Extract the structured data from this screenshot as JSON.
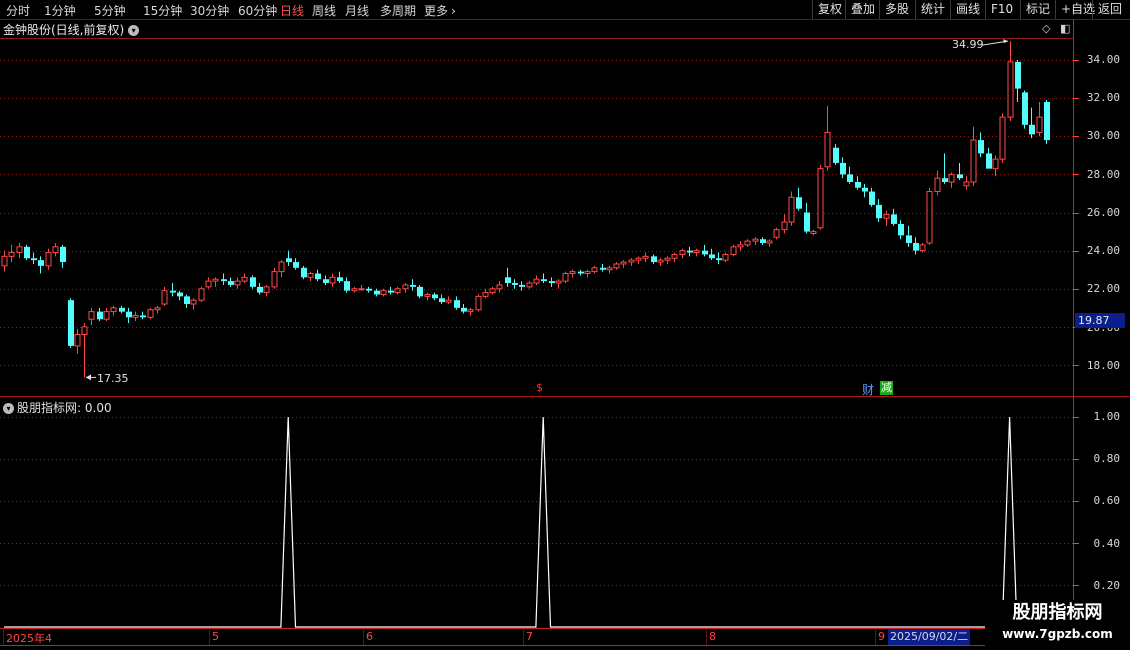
{
  "toolbar": {
    "periods": [
      {
        "label": "分时",
        "active": false
      },
      {
        "label": "1分钟",
        "active": false
      },
      {
        "label": "5分钟",
        "active": false
      },
      {
        "label": "15分钟",
        "active": false
      },
      {
        "label": "30分钟",
        "active": false
      },
      {
        "label": "60分钟",
        "active": false
      },
      {
        "label": "日线",
        "active": true
      },
      {
        "label": "周线",
        "active": false
      },
      {
        "label": "月线",
        "active": false
      },
      {
        "label": "多周期",
        "active": false
      },
      {
        "label": "更多",
        "active": false
      }
    ],
    "more_arrow": "›",
    "right_buttons": [
      "复权",
      "叠加",
      "多股",
      "统计",
      "画线",
      "F10",
      "标记",
      "+自选",
      "返回"
    ]
  },
  "main_chart": {
    "title": "金钟股份(日线,前复权)",
    "y_labels": [
      "34.00",
      "32.00",
      "30.00",
      "28.00",
      "26.00",
      "24.00",
      "22.00",
      "20.00",
      "18.00"
    ],
    "current_price": "19.87",
    "high_label": "34.99",
    "low_label": "17.35",
    "events": {
      "s": "$",
      "cai": "财",
      "jian": "减"
    },
    "colors": {
      "up": "#ff4848",
      "down": "#54fcfc",
      "grid": "#8b1a1a",
      "axis": "#ff3c3c"
    }
  },
  "indicator": {
    "name": "股朋指标网",
    "value_text": ": 0.00",
    "y_labels": [
      "1.00",
      "0.80",
      "0.60",
      "0.40",
      "0.20"
    ],
    "line_color": "#ffffff"
  },
  "time_axis": {
    "labels": [
      "2025年4",
      "5",
      "6",
      "7",
      "8",
      "9"
    ],
    "cursor_date": "2025/09/02/二"
  },
  "watermark": {
    "line1": "股朋指标网",
    "line2": "www.7gpzb.com"
  },
  "chart_data": {
    "type": "candlestick",
    "ylim": [
      17,
      35.5
    ],
    "high": 34.99,
    "low": 17.35,
    "ohlc": [
      [
        23.2,
        24.0,
        22.9,
        23.7
      ],
      [
        23.7,
        24.3,
        23.4,
        23.9
      ],
      [
        23.9,
        24.4,
        23.6,
        24.2
      ],
      [
        24.2,
        24.3,
        23.5,
        23.6
      ],
      [
        23.6,
        23.9,
        23.3,
        23.5
      ],
      [
        23.5,
        23.7,
        22.8,
        23.2
      ],
      [
        23.2,
        24.1,
        23.0,
        23.9
      ],
      [
        23.9,
        24.4,
        23.7,
        24.2
      ],
      [
        24.2,
        24.3,
        23.1,
        23.4
      ],
      [
        21.4,
        21.5,
        18.9,
        19.0
      ],
      [
        19.0,
        19.9,
        18.6,
        19.6
      ],
      [
        19.6,
        20.2,
        17.35,
        20.0
      ],
      [
        20.4,
        21.0,
        20.1,
        20.8
      ],
      [
        20.8,
        21.0,
        20.3,
        20.4
      ],
      [
        20.4,
        21.0,
        20.3,
        20.8
      ],
      [
        20.8,
        21.1,
        20.6,
        21.0
      ],
      [
        21.0,
        21.1,
        20.7,
        20.8
      ],
      [
        20.8,
        21.0,
        20.2,
        20.5
      ],
      [
        20.5,
        20.8,
        20.3,
        20.6
      ],
      [
        20.6,
        20.8,
        20.4,
        20.5
      ],
      [
        20.5,
        21.0,
        20.4,
        20.9
      ],
      [
        20.9,
        21.1,
        20.7,
        21.0
      ],
      [
        21.2,
        22.1,
        21.1,
        21.9
      ],
      [
        21.9,
        22.3,
        21.6,
        21.8
      ],
      [
        21.8,
        21.9,
        21.4,
        21.6
      ],
      [
        21.6,
        21.7,
        21.0,
        21.2
      ],
      [
        21.2,
        21.5,
        20.9,
        21.4
      ],
      [
        21.4,
        22.1,
        21.3,
        22.0
      ],
      [
        22.1,
        22.6,
        22.0,
        22.4
      ],
      [
        22.4,
        22.6,
        22.1,
        22.5
      ],
      [
        22.5,
        22.8,
        22.2,
        22.4
      ],
      [
        22.4,
        22.6,
        22.1,
        22.2
      ],
      [
        22.2,
        22.6,
        22.0,
        22.4
      ],
      [
        22.4,
        22.8,
        22.3,
        22.6
      ],
      [
        22.6,
        22.7,
        22.0,
        22.1
      ],
      [
        22.1,
        22.3,
        21.7,
        21.8
      ],
      [
        21.8,
        22.2,
        21.6,
        22.1
      ],
      [
        22.1,
        23.1,
        22.0,
        22.9
      ],
      [
        22.9,
        23.5,
        22.6,
        23.4
      ],
      [
        23.6,
        24.0,
        23.2,
        23.4
      ],
      [
        23.4,
        23.6,
        23.0,
        23.1
      ],
      [
        23.1,
        23.2,
        22.5,
        22.6
      ],
      [
        22.6,
        22.9,
        22.4,
        22.8
      ],
      [
        22.8,
        23.0,
        22.4,
        22.5
      ],
      [
        22.5,
        22.7,
        22.2,
        22.3
      ],
      [
        22.3,
        22.8,
        22.1,
        22.6
      ],
      [
        22.6,
        22.9,
        22.3,
        22.4
      ],
      [
        22.4,
        22.6,
        21.8,
        21.9
      ],
      [
        21.9,
        22.1,
        21.8,
        22.0
      ],
      [
        22.0,
        22.2,
        21.9,
        22.0
      ],
      [
        22.0,
        22.1,
        21.8,
        21.9
      ],
      [
        21.9,
        22.0,
        21.6,
        21.7
      ],
      [
        21.7,
        22.0,
        21.6,
        21.9
      ],
      [
        21.9,
        22.1,
        21.7,
        21.8
      ],
      [
        21.8,
        22.1,
        21.7,
        22.0
      ],
      [
        22.0,
        22.3,
        21.8,
        22.2
      ],
      [
        22.2,
        22.5,
        21.9,
        22.1
      ],
      [
        22.1,
        22.2,
        21.5,
        21.6
      ],
      [
        21.6,
        21.8,
        21.4,
        21.7
      ],
      [
        21.7,
        21.8,
        21.4,
        21.5
      ],
      [
        21.5,
        21.7,
        21.2,
        21.3
      ],
      [
        21.3,
        21.6,
        21.2,
        21.4
      ],
      [
        21.4,
        21.6,
        20.9,
        21.0
      ],
      [
        21.0,
        21.2,
        20.7,
        20.8
      ],
      [
        20.8,
        21.0,
        20.6,
        20.9
      ],
      [
        20.9,
        21.7,
        20.8,
        21.6
      ],
      [
        21.6,
        22.0,
        21.5,
        21.8
      ],
      [
        21.8,
        22.1,
        21.7,
        22.0
      ],
      [
        22.0,
        22.4,
        21.8,
        22.2
      ],
      [
        22.6,
        23.1,
        22.1,
        22.3
      ],
      [
        22.3,
        22.5,
        22.0,
        22.2
      ],
      [
        22.2,
        22.4,
        21.9,
        22.1
      ],
      [
        22.1,
        22.4,
        22.0,
        22.3
      ],
      [
        22.3,
        22.7,
        22.2,
        22.5
      ],
      [
        22.5,
        22.8,
        22.3,
        22.4
      ],
      [
        22.4,
        22.6,
        22.1,
        22.3
      ],
      [
        22.3,
        22.5,
        22.0,
        22.4
      ],
      [
        22.4,
        22.9,
        22.3,
        22.8
      ],
      [
        22.8,
        23.0,
        22.6,
        22.9
      ],
      [
        22.9,
        23.0,
        22.7,
        22.8
      ],
      [
        22.8,
        23.0,
        22.6,
        22.9
      ],
      [
        22.9,
        23.2,
        22.8,
        23.1
      ],
      [
        23.1,
        23.3,
        22.9,
        23.0
      ],
      [
        23.0,
        23.2,
        22.8,
        23.1
      ],
      [
        23.1,
        23.4,
        23.0,
        23.3
      ],
      [
        23.3,
        23.5,
        23.1,
        23.4
      ],
      [
        23.4,
        23.6,
        23.2,
        23.5
      ],
      [
        23.5,
        23.7,
        23.3,
        23.6
      ],
      [
        23.6,
        23.9,
        23.4,
        23.7
      ],
      [
        23.7,
        23.8,
        23.3,
        23.4
      ],
      [
        23.4,
        23.6,
        23.2,
        23.5
      ],
      [
        23.5,
        23.7,
        23.3,
        23.6
      ],
      [
        23.6,
        23.9,
        23.4,
        23.8
      ],
      [
        23.8,
        24.1,
        23.6,
        24.0
      ],
      [
        24.0,
        24.2,
        23.7,
        23.9
      ],
      [
        23.9,
        24.1,
        23.7,
        24.0
      ],
      [
        24.0,
        24.3,
        23.7,
        23.8
      ],
      [
        23.8,
        24.1,
        23.5,
        23.6
      ],
      [
        23.6,
        23.9,
        23.3,
        23.5
      ],
      [
        23.5,
        23.9,
        23.4,
        23.8
      ],
      [
        23.8,
        24.3,
        23.7,
        24.2
      ],
      [
        24.2,
        24.5,
        24.0,
        24.3
      ],
      [
        24.3,
        24.6,
        24.2,
        24.5
      ],
      [
        24.5,
        24.7,
        24.3,
        24.6
      ],
      [
        24.6,
        24.7,
        24.3,
        24.4
      ],
      [
        24.4,
        24.6,
        24.2,
        24.5
      ],
      [
        24.7,
        25.2,
        24.6,
        25.1
      ],
      [
        25.1,
        25.9,
        24.9,
        25.5
      ],
      [
        25.5,
        27.1,
        25.3,
        26.8
      ],
      [
        26.8,
        27.3,
        26.1,
        26.2
      ],
      [
        26.0,
        26.5,
        24.9,
        25.0
      ],
      [
        24.9,
        25.1,
        24.8,
        25.0
      ],
      [
        25.2,
        28.5,
        25.1,
        28.3
      ],
      [
        28.4,
        31.6,
        28.2,
        30.2
      ],
      [
        29.4,
        29.6,
        28.5,
        28.6
      ],
      [
        28.6,
        28.9,
        27.8,
        28.0
      ],
      [
        28.0,
        28.4,
        27.5,
        27.6
      ],
      [
        27.6,
        27.9,
        27.2,
        27.3
      ],
      [
        27.3,
        27.5,
        26.8,
        27.1
      ],
      [
        27.1,
        27.3,
        26.3,
        26.4
      ],
      [
        26.4,
        26.7,
        25.5,
        25.7
      ],
      [
        25.7,
        26.1,
        25.3,
        25.9
      ],
      [
        25.9,
        26.2,
        25.3,
        25.4
      ],
      [
        25.4,
        25.6,
        24.6,
        24.8
      ],
      [
        24.8,
        25.3,
        24.2,
        24.4
      ],
      [
        24.4,
        24.7,
        23.8,
        24.0
      ],
      [
        24.0,
        24.4,
        23.9,
        24.3
      ],
      [
        24.4,
        27.3,
        24.3,
        27.1
      ],
      [
        27.1,
        28.2,
        26.9,
        27.8
      ],
      [
        27.8,
        29.1,
        27.5,
        27.6
      ],
      [
        27.6,
        28.1,
        27.3,
        28.0
      ],
      [
        28.0,
        28.6,
        27.7,
        27.8
      ],
      [
        27.4,
        27.9,
        27.2,
        27.6
      ],
      [
        27.6,
        30.5,
        27.4,
        29.8
      ],
      [
        29.8,
        30.2,
        28.9,
        29.1
      ],
      [
        29.1,
        29.4,
        28.6,
        28.3
      ],
      [
        28.3,
        29.0,
        27.9,
        28.8
      ],
      [
        28.8,
        31.2,
        28.6,
        31.0
      ],
      [
        31.0,
        34.99,
        30.8,
        33.9
      ],
      [
        33.9,
        34.0,
        31.8,
        32.5
      ],
      [
        32.3,
        32.4,
        30.4,
        30.6
      ],
      [
        30.6,
        31.5,
        29.9,
        30.1
      ],
      [
        30.2,
        31.8,
        30.0,
        31.0
      ],
      [
        31.8,
        31.9,
        29.6,
        29.8
      ]
    ],
    "indicator_peaks": [
      {
        "index": 39,
        "value": 1.0
      },
      {
        "index": 74,
        "value": 1.0
      },
      {
        "index": 138,
        "value": 1.0
      }
    ]
  }
}
